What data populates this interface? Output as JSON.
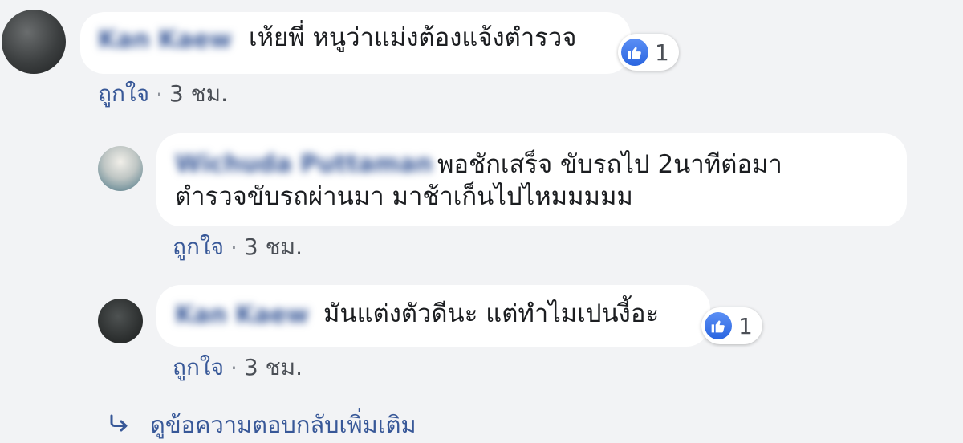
{
  "comments": [
    {
      "author": "Kan Kaew",
      "text_lines": [
        "เห้ยพี่ หนูว่าแม่งต้องแจ้งตำรวจ"
      ],
      "like_count": "1",
      "like_label": "ถูกใจ",
      "separator": "·",
      "time": "3 ชม."
    },
    {
      "author": "Wichuda Puttaman",
      "text_lines": [
        "พอชักเสร็จ ขับรถไป 2นาทีต่อมา",
        "ตำรวจขับรถผ่านมา มาช้าเก็นไปไหมมมมม"
      ],
      "like_label": "ถูกใจ",
      "separator": "·",
      "time": "3 ชม."
    },
    {
      "author": "Kan Kaew",
      "text_lines": [
        "มันแต่งตัวดีนะ แต่ทำไมเปนงี้อะ"
      ],
      "like_count": "1",
      "like_label": "ถูกใจ",
      "separator": "·",
      "time": "3 ชม."
    }
  ],
  "more_replies": {
    "label": "ดูข้อความตอบกลับเพิ่มเติม",
    "icon": "reply-arrow-icon"
  },
  "colors": {
    "background": "#f2f3f5",
    "bubble": "#ffffff",
    "link": "#385898",
    "like_badge": "#3b73e8"
  }
}
